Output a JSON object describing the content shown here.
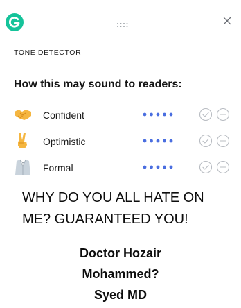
{
  "panel": {
    "app": "Grammarly",
    "logo_letter": "G",
    "logo_color": "#15c39a",
    "close_icon": "close-icon",
    "drag_icon": "drag-handle-icon",
    "section_label": "TONE DETECTOR",
    "title": "How this may sound to readers:",
    "intensity_color": "#4a6ee0",
    "tones": [
      {
        "label": "Confident",
        "icon": "handshake-emoji-icon",
        "intensity": 5
      },
      {
        "label": "Optimistic",
        "icon": "victory-hand-emoji-icon",
        "intensity": 5
      },
      {
        "label": "Formal",
        "icon": "tuxedo-emoji-icon",
        "intensity": 5
      }
    ]
  },
  "caption": {
    "line1": "WHY DO YOU ALL HATE ON",
    "line2": "ME? GUARANTEED YOU!",
    "signature_line1": "Doctor Hozair",
    "signature_line2": "Mohammed?",
    "signature_line3": "Syed MD"
  }
}
